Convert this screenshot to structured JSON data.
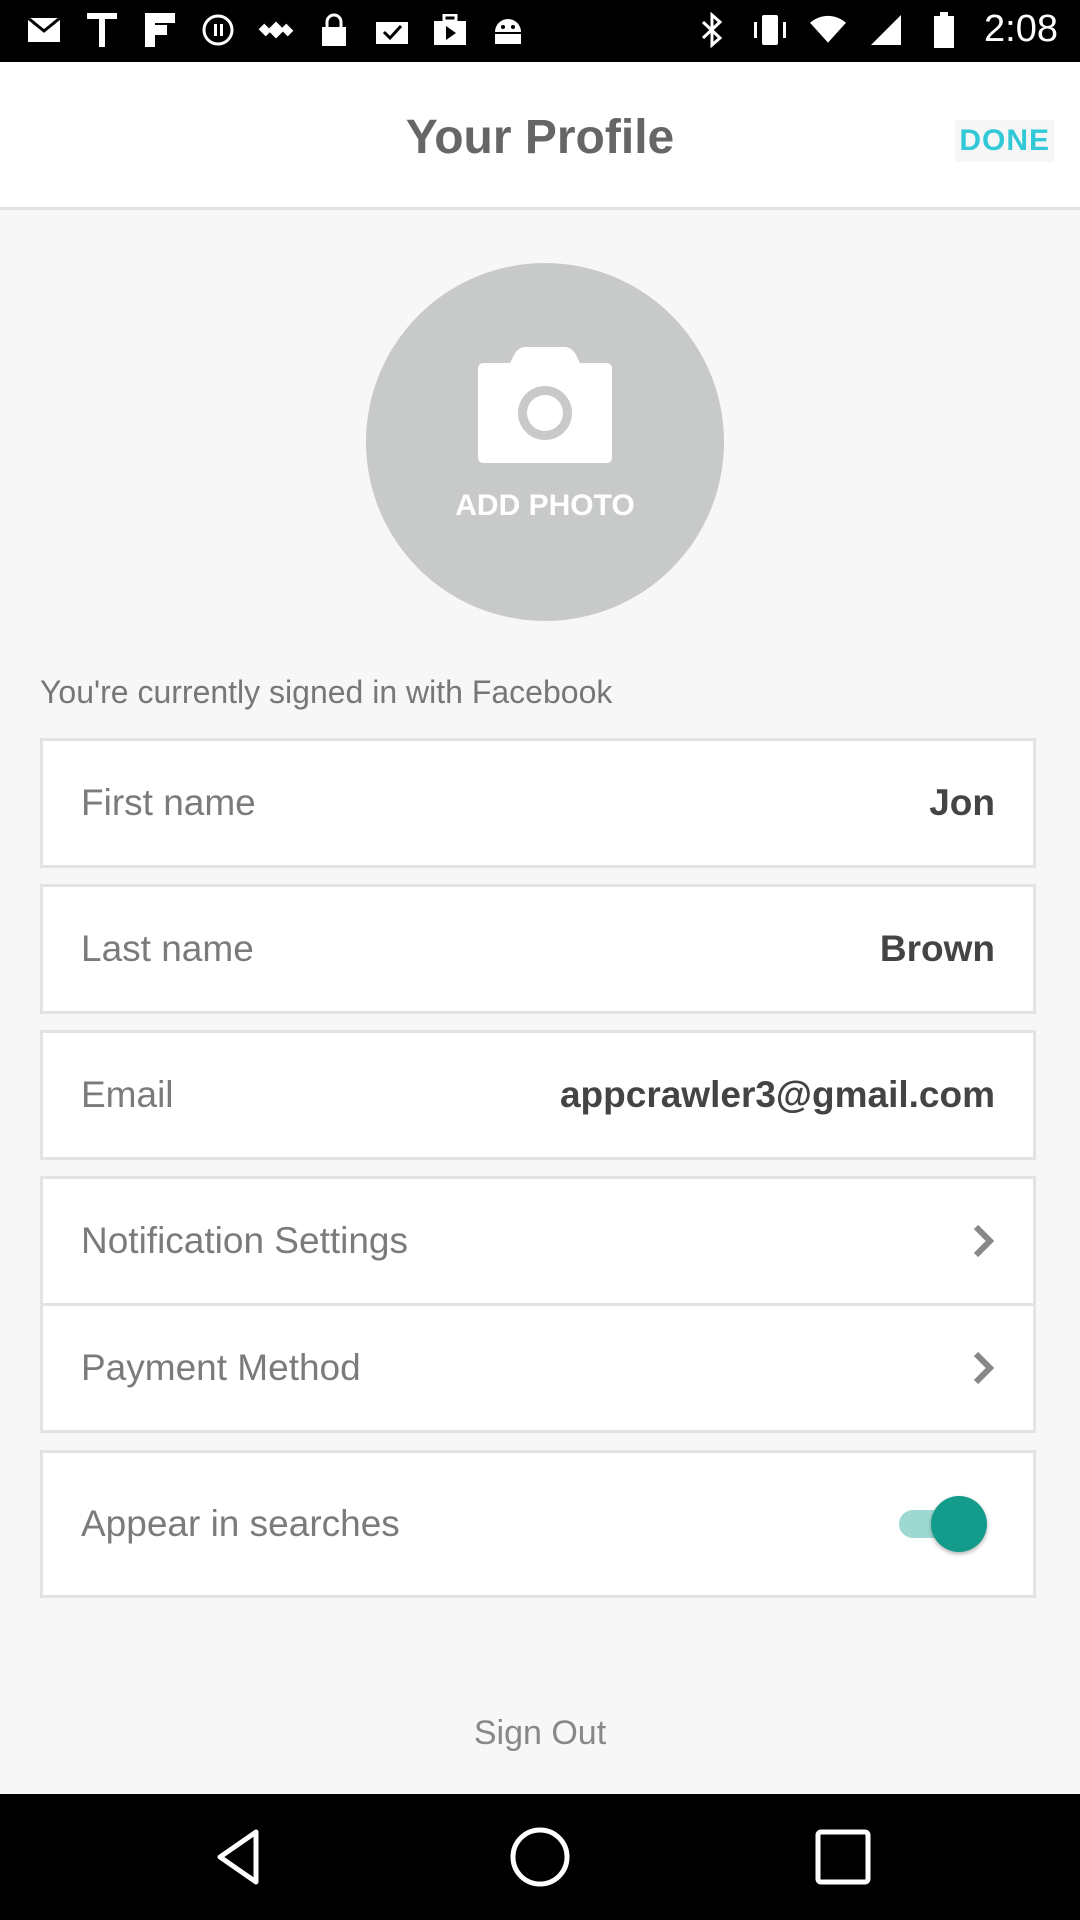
{
  "status_bar": {
    "time": "2:08",
    "left_icons": [
      "mail-icon",
      "text-icon",
      "flipboard-icon",
      "circle-icon",
      "satellite-icon",
      "lock-icon",
      "clipboard-check-icon",
      "briefcase-play-icon",
      "android-icon"
    ],
    "right_icons": [
      "bluetooth-icon",
      "vibrate-icon",
      "wifi-icon",
      "signal-icon",
      "battery-icon"
    ]
  },
  "header": {
    "title": "Your Profile",
    "done_label": "DONE"
  },
  "photo": {
    "label": "ADD PHOTO"
  },
  "signed_in_text": "You're currently signed in with Facebook",
  "fields": {
    "first_name": {
      "label": "First name",
      "value": "Jon"
    },
    "last_name": {
      "label": "Last name",
      "value": "Brown"
    },
    "email": {
      "label": "Email",
      "value": "appcrawler3@gmail.com"
    }
  },
  "menu": {
    "notification_settings": "Notification Settings",
    "payment_method": "Payment Method"
  },
  "appear_in_searches": {
    "label": "Appear in searches",
    "enabled": true
  },
  "sign_out_label": "Sign Out",
  "colors": {
    "accent": "#31c8d8",
    "toggle_on": "#139b8b"
  }
}
